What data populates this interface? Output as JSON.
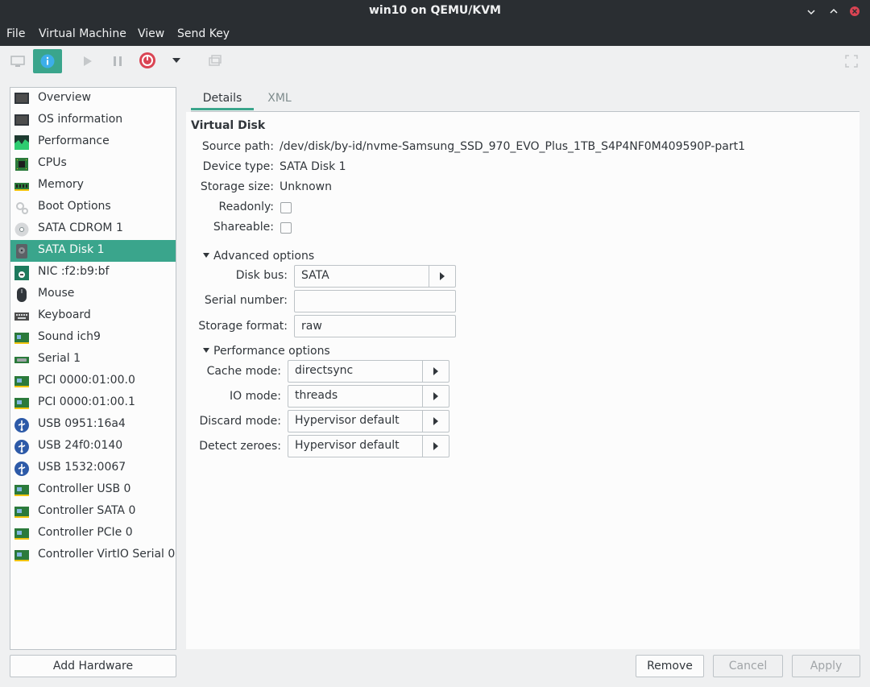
{
  "window": {
    "title": "win10 on QEMU/KVM"
  },
  "menu": {
    "items": [
      "File",
      "Virtual Machine",
      "View",
      "Send Key"
    ]
  },
  "sidebar": {
    "items": [
      {
        "label": "Overview",
        "icon": "monitor-icon"
      },
      {
        "label": "OS information",
        "icon": "monitor-icon"
      },
      {
        "label": "Performance",
        "icon": "performance-graph-icon"
      },
      {
        "label": "CPUs",
        "icon": "cpu-chip-icon"
      },
      {
        "label": "Memory",
        "icon": "memory-stick-icon"
      },
      {
        "label": "Boot Options",
        "icon": "gears-icon"
      },
      {
        "label": "SATA CDROM 1",
        "icon": "cdrom-icon"
      },
      {
        "label": "SATA Disk 1",
        "icon": "hard-disk-icon"
      },
      {
        "label": "NIC :f2:b9:bf",
        "icon": "network-card-icon"
      },
      {
        "label": "Mouse",
        "icon": "mouse-icon"
      },
      {
        "label": "Keyboard",
        "icon": "keyboard-icon"
      },
      {
        "label": "Sound ich9",
        "icon": "sound-card-icon"
      },
      {
        "label": "Serial 1",
        "icon": "serial-port-icon"
      },
      {
        "label": "PCI 0000:01:00.0",
        "icon": "pci-card-icon"
      },
      {
        "label": "PCI 0000:01:00.1",
        "icon": "pci-card-icon"
      },
      {
        "label": "USB 0951:16a4",
        "icon": "usb-icon"
      },
      {
        "label": "USB 24f0:0140",
        "icon": "usb-icon"
      },
      {
        "label": "USB 1532:0067",
        "icon": "usb-icon"
      },
      {
        "label": "Controller USB 0",
        "icon": "pci-card-icon"
      },
      {
        "label": "Controller SATA 0",
        "icon": "pci-card-icon"
      },
      {
        "label": "Controller PCIe 0",
        "icon": "pci-card-icon"
      },
      {
        "label": "Controller VirtIO Serial 0",
        "icon": "pci-card-icon"
      }
    ],
    "selected_index": 7,
    "add_hardware": "Add Hardware"
  },
  "tabs": [
    "Details",
    "XML"
  ],
  "details": {
    "section_title": "Virtual Disk",
    "source_path_label": "Source path:",
    "source_path": "/dev/disk/by-id/nvme-Samsung_SSD_970_EVO_Plus_1TB_S4P4NF0M409590P-part1",
    "device_type_label": "Device type:",
    "device_type": "SATA Disk 1",
    "storage_size_label": "Storage size:",
    "storage_size": "Unknown",
    "readonly_label": "Readonly:",
    "readonly": false,
    "shareable_label": "Shareable:",
    "shareable": false,
    "advanced": {
      "title": "Advanced options",
      "disk_bus_label": "Disk bus:",
      "disk_bus": "SATA",
      "serial_label": "Serial number:",
      "serial": "",
      "storage_format_label": "Storage format:",
      "storage_format": "raw"
    },
    "performance": {
      "title": "Performance options",
      "cache_mode_label": "Cache mode:",
      "cache_mode": "directsync",
      "io_mode_label": "IO mode:",
      "io_mode": "threads",
      "discard_mode_label": "Discard mode:",
      "discard_mode": "Hypervisor default",
      "detect_zeroes_label": "Detect zeroes:",
      "detect_zeroes": "Hypervisor default"
    }
  },
  "buttons": {
    "remove": "Remove",
    "cancel": "Cancel",
    "apply": "Apply"
  },
  "colors": {
    "accent": "#3aa58c",
    "power": "#da4453",
    "usb": "#2d5aa8",
    "titlebar": "#2a2e32"
  }
}
